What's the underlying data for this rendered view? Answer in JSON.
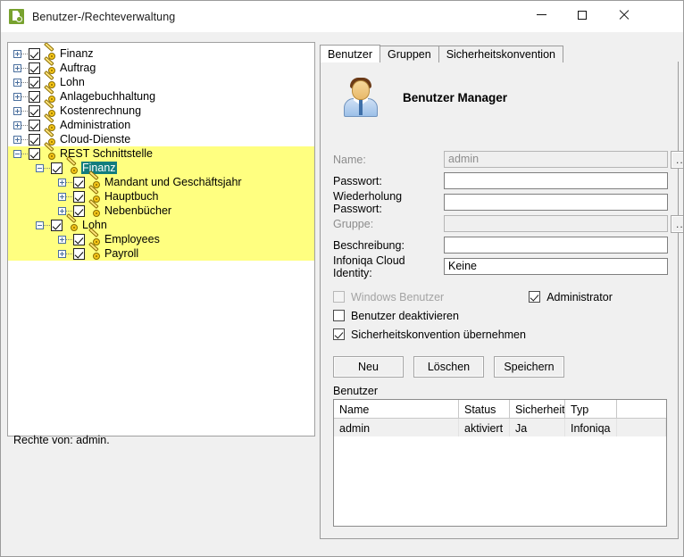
{
  "window": {
    "title": "Benutzer-/Rechteverwaltung",
    "icon": "app-document-icon",
    "minimize_label": "–",
    "maximize_label": "□",
    "close_label": "✕",
    "accent_green": "#78a22f"
  },
  "tree": {
    "highlight_color": "#ffff80",
    "selection_color": "#137d7d",
    "nodes": [
      {
        "label": "Finanz",
        "depth": 0,
        "expander": "plus",
        "checked": true,
        "highlighted": false,
        "selected": false
      },
      {
        "label": "Auftrag",
        "depth": 0,
        "expander": "plus",
        "checked": true,
        "highlighted": false,
        "selected": false
      },
      {
        "label": "Lohn",
        "depth": 0,
        "expander": "plus",
        "checked": true,
        "highlighted": false,
        "selected": false
      },
      {
        "label": "Anlagebuchhaltung",
        "depth": 0,
        "expander": "plus",
        "checked": true,
        "highlighted": false,
        "selected": false
      },
      {
        "label": "Kostenrechnung",
        "depth": 0,
        "expander": "plus",
        "checked": true,
        "highlighted": false,
        "selected": false
      },
      {
        "label": "Administration",
        "depth": 0,
        "expander": "plus",
        "checked": true,
        "highlighted": false,
        "selected": false
      },
      {
        "label": "Cloud-Dienste",
        "depth": 0,
        "expander": "plus",
        "checked": true,
        "highlighted": false,
        "selected": false
      },
      {
        "label": "REST Schnittstelle",
        "depth": 0,
        "expander": "minus",
        "checked": true,
        "highlighted": true,
        "selected": false
      },
      {
        "label": "Finanz",
        "depth": 1,
        "expander": "minus",
        "checked": true,
        "highlighted": true,
        "selected": true
      },
      {
        "label": "Mandant und Geschäftsjahr",
        "depth": 2,
        "expander": "plus",
        "checked": true,
        "highlighted": true,
        "selected": false
      },
      {
        "label": "Hauptbuch",
        "depth": 2,
        "expander": "plus",
        "checked": true,
        "highlighted": true,
        "selected": false
      },
      {
        "label": "Nebenbücher",
        "depth": 2,
        "expander": "plus",
        "checked": true,
        "highlighted": true,
        "selected": false
      },
      {
        "label": "Lohn",
        "depth": 1,
        "expander": "minus",
        "checked": true,
        "highlighted": true,
        "selected": false
      },
      {
        "label": "Employees",
        "depth": 2,
        "expander": "plus",
        "checked": true,
        "highlighted": true,
        "selected": false
      },
      {
        "label": "Payroll",
        "depth": 2,
        "expander": "plus",
        "checked": true,
        "highlighted": true,
        "selected": false
      }
    ]
  },
  "status": {
    "text": "Rechte von: admin."
  },
  "tabs": [
    {
      "label": "Benutzer",
      "active": true
    },
    {
      "label": "Gruppen",
      "active": false
    },
    {
      "label": "Sicherheitskonvention",
      "active": false
    }
  ],
  "panel_header": {
    "title": "Benutzer Manager",
    "avatar_icon": "user-avatar-icon"
  },
  "form": {
    "browse_label": "...",
    "fields": [
      {
        "label": "Name:",
        "value": "admin",
        "placeholder": "",
        "readonly": true,
        "dim_label": true,
        "browse": true
      },
      {
        "label": "Passwort:",
        "value": "",
        "placeholder": "",
        "readonly": false,
        "dim_label": false,
        "browse": false
      },
      {
        "label": "Wiederholung Passwort:",
        "value": "",
        "placeholder": "",
        "readonly": false,
        "dim_label": false,
        "browse": false
      },
      {
        "label": "Gruppe:",
        "value": "",
        "placeholder": "",
        "readonly": true,
        "dim_label": true,
        "browse": true
      },
      {
        "label": "Beschreibung:",
        "value": "",
        "placeholder": "",
        "readonly": false,
        "dim_label": false,
        "browse": false
      },
      {
        "label": "Infoniqa Cloud Identity:",
        "value": "Keine",
        "placeholder": "",
        "readonly": false,
        "dim_label": false,
        "browse": false
      }
    ]
  },
  "checkboxes": {
    "windows_benutzer": {
      "label": "Windows Benutzer",
      "checked": false,
      "disabled": true
    },
    "administrator": {
      "label": "Administrator",
      "checked": true,
      "disabled": false
    },
    "benutzer_deakt": {
      "label": "Benutzer deaktivieren",
      "checked": false,
      "disabled": false
    },
    "sicherheitskonv": {
      "label": "Sicherheitskonvention übernehmen",
      "checked": true,
      "disabled": false
    }
  },
  "buttons": {
    "new": "Neu",
    "delete": "Löschen",
    "save": "Speichern"
  },
  "table": {
    "caption": "Benutzer",
    "columns": [
      "Name",
      "Status",
      "Sicherheit",
      "Typ"
    ],
    "rows": [
      [
        "admin",
        "aktiviert",
        "Ja",
        "Infoniqa"
      ]
    ]
  }
}
